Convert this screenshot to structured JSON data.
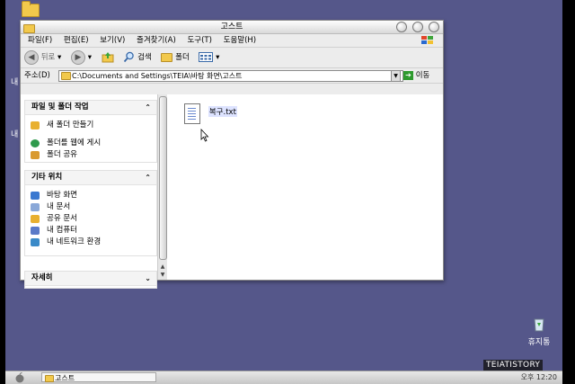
{
  "desktop": {
    "recycle_bin_label": "휴지통",
    "edge_labels": [
      "내",
      "내"
    ]
  },
  "window": {
    "title": "고스트",
    "menu": [
      "파일(F)",
      "편집(E)",
      "보기(V)",
      "즐겨찾기(A)",
      "도구(T)",
      "도움말(H)"
    ],
    "toolbar": {
      "back": "뒤로",
      "search": "검색",
      "folders": "폴더"
    },
    "address": {
      "label": "주소(D)",
      "path": "C:\\Documents and Settings\\TEIA\\바탕 화면\\고스트",
      "go": "이동"
    },
    "panels": [
      {
        "title": "파일 및 폴더 작업",
        "items": [
          {
            "label": "새 폴더 만들기",
            "icon": "new-folder-icon",
            "color": "#e8b030"
          },
          {
            "label": "폴더를 웹에 게시",
            "icon": "globe-icon",
            "color": "#2f9a4c"
          },
          {
            "label": "폴더 공유",
            "icon": "share-folder-icon",
            "color": "#d99a30"
          }
        ]
      },
      {
        "title": "기타 위치",
        "items": [
          {
            "label": "바탕 화면",
            "icon": "desktop-icon",
            "color": "#3a78d0"
          },
          {
            "label": "내 문서",
            "icon": "documents-icon",
            "color": "#8aa8d8"
          },
          {
            "label": "공유 문서",
            "icon": "shared-documents-icon",
            "color": "#e8b030"
          },
          {
            "label": "내 컴퓨터",
            "icon": "computer-icon",
            "color": "#5a7ac8"
          },
          {
            "label": "내 네트워크 환경",
            "icon": "network-icon",
            "color": "#3a8ac8"
          }
        ]
      },
      {
        "title": "자세히",
        "items": []
      }
    ],
    "files": [
      {
        "name": "복구.txt",
        "icon": "text-file-icon"
      }
    ]
  },
  "taskbar": {
    "task_label": "고스트",
    "clock": "오후 12:20"
  },
  "watermark": "TEIATISTORY",
  "colors": {
    "desktop": "#55578a",
    "go_arrow": "#2e9a2e",
    "address_up_icon": "#3aa63a"
  }
}
